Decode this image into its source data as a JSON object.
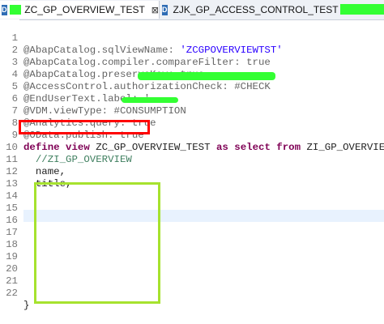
{
  "tabs": [
    {
      "label": "ZC_GP_OVERVIEW_TEST",
      "close": "⊠"
    },
    {
      "label": "ZJK_GP_ACCESS_CONTROL_TEST",
      "chevron": "»"
    }
  ],
  "file_icon_letter": "D",
  "lines": [
    {
      "n": "1",
      "code": "@AbapCatalog.sqlViewName: 'ZCGPOVERVIEWTST'"
    },
    {
      "n": "2",
      "code": "@AbapCatalog.compiler.compareFilter: true"
    },
    {
      "n": "3",
      "code": "@AbapCatalog.preserveKey: true"
    },
    {
      "n": "4",
      "code": "@AccessControl.authorizationCheck: #CHECK"
    },
    {
      "n": "5",
      "code": "@EndUserText.label: '"
    },
    {
      "n": "6",
      "code": "@VDM.viewType: #CONSUMPTION"
    },
    {
      "n": "7",
      "code": "@Analytics.query: true"
    },
    {
      "n": "8",
      "code": "@OData.publish: true"
    },
    {
      "n": "9",
      "code": "define view ZC_GP_OVERVIEW_TEST as select from ZI_GP_OVERVIEW {"
    },
    {
      "n": "10",
      "code": "  //ZI_GP_OVERVIEW"
    },
    {
      "n": "11",
      "code": "  name,"
    },
    {
      "n": "12",
      "code": "  title,"
    },
    {
      "n": "13",
      "code": ""
    },
    {
      "n": "14",
      "code": ""
    },
    {
      "n": "15",
      "code": ""
    },
    {
      "n": "16",
      "code": ""
    },
    {
      "n": "17",
      "code": ""
    },
    {
      "n": "18",
      "code": ""
    },
    {
      "n": "19",
      "code": ""
    },
    {
      "n": "20",
      "code": ""
    },
    {
      "n": "21",
      "code": ""
    },
    {
      "n": "22",
      "code": "}"
    }
  ],
  "colors": {
    "annotation": "#646464",
    "string": "#2a00ff",
    "keyword": "#7f0055",
    "comment": "#3f7f5f",
    "red_box": "#ff0000",
    "green_box": "#a6e22e",
    "highlighter": "#33ff33"
  }
}
